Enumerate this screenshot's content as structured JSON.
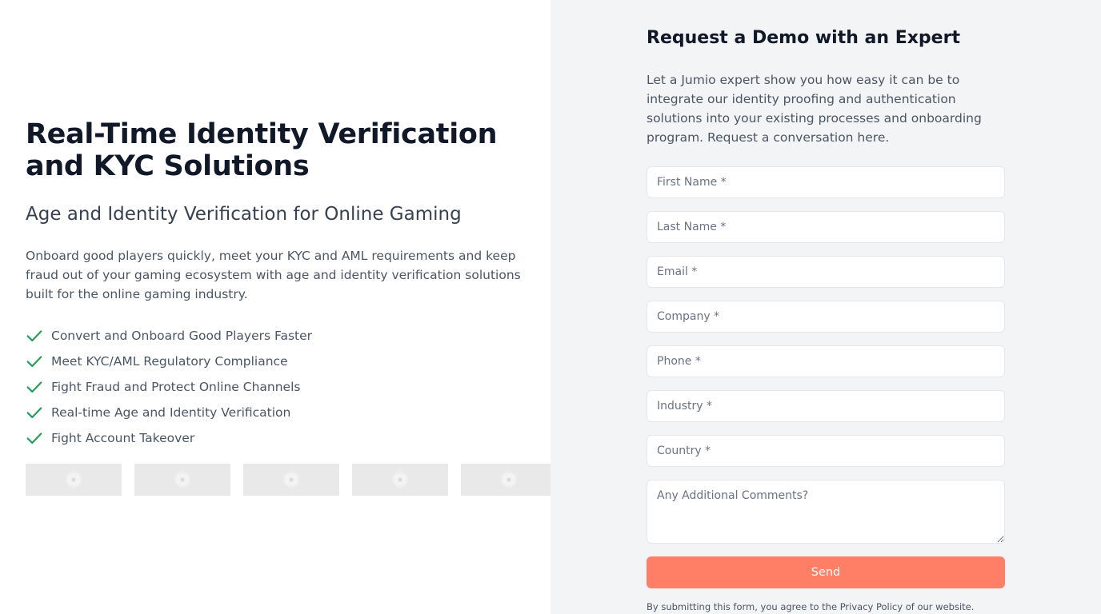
{
  "hero": {
    "title": "Real-Time Identity Verification and KYC Solutions",
    "subtitle": "Age and Identity Verification for Online Gaming",
    "description": "Onboard good players quickly, meet your KYC and AML requirements and keep fraud out of your gaming ecosystem with age and identity verification solutions built for the online gaming industry.",
    "benefits": [
      "Convert and Onboard Good Players Faster",
      "Meet KYC/AML Regulatory Compliance",
      "Fight Fraud and Protect Online Channels",
      "Real-time Age and Identity Verification",
      "Fight Account Takeover"
    ],
    "check_color": "#22a05b"
  },
  "logos": [
    {
      "icon": "loading-spinner-icon"
    },
    {
      "icon": "loading-spinner-icon"
    },
    {
      "icon": "loading-spinner-icon"
    },
    {
      "icon": "loading-spinner-icon"
    },
    {
      "icon": "loading-spinner-icon"
    }
  ],
  "form": {
    "title": "Request a Demo with an Expert",
    "intro": "Let a Jumio expert show you how easy it can be to integrate our identity proofing and authentication solutions into your existing processes and onboarding program. Request a conversation here.",
    "fields": {
      "first_name": {
        "placeholder": "First Name *",
        "value": ""
      },
      "last_name": {
        "placeholder": "Last Name *",
        "value": ""
      },
      "email": {
        "placeholder": "Email *",
        "value": ""
      },
      "company": {
        "placeholder": "Company *",
        "value": ""
      },
      "phone": {
        "placeholder": "Phone *",
        "value": ""
      },
      "industry": {
        "placeholder": "Industry *",
        "value": ""
      },
      "country": {
        "placeholder": "Country *",
        "value": ""
      },
      "comments": {
        "placeholder": "Any Additional Comments?",
        "value": ""
      }
    },
    "submit_label": "Send",
    "submit_color": "#ff7f66",
    "legal": "By submitting this form, you agree to the Privacy Policy of our website."
  }
}
